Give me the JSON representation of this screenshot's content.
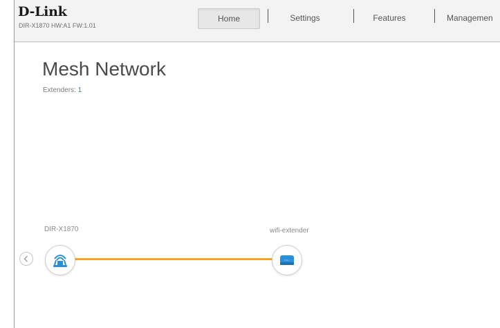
{
  "header": {
    "brand": "D-Link",
    "model_info": "DIR-X1870 HW:A1 FW:1.01"
  },
  "nav": {
    "tabs": [
      {
        "label": "Home",
        "active": true
      },
      {
        "label": "Settings",
        "active": false
      },
      {
        "label": "Features",
        "active": false
      },
      {
        "label": "Managemen",
        "active": false
      }
    ]
  },
  "main": {
    "title": "Mesh Network",
    "extenders_label": "Extenders:",
    "extenders_count": "1"
  },
  "mesh": {
    "router": {
      "label": "DIR-X1870",
      "icon": "router-icon"
    },
    "extender": {
      "label": "wifi-extender",
      "icon": "extender-icon"
    },
    "link_color": "#f5a623",
    "icon_color": "#2a8fd6"
  }
}
